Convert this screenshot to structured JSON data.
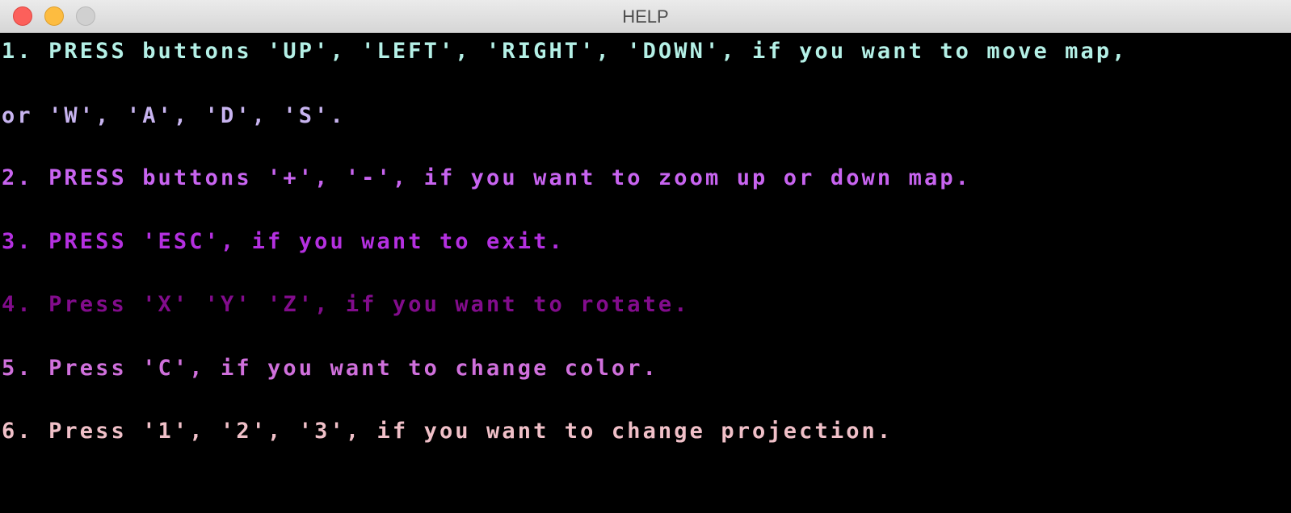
{
  "window": {
    "title": "HELP"
  },
  "help_lines": [
    {
      "text": "1. PRESS buttons 'UP', 'LEFT', 'RIGHT', 'DOWN', if you want to move map,",
      "color": "#b4f0e6"
    },
    {
      "text": "or 'W', 'A', 'D', 'S'.",
      "color": "#c8b4f0"
    },
    {
      "text": "2. PRESS buttons '+', '-', if you want to zoom up or down map.",
      "color": "#c864f0"
    },
    {
      "text": "3. PRESS 'ESC', if you want to exit.",
      "color": "#b430e0"
    },
    {
      "text": "4. Press 'X' 'Y' 'Z', if you want to rotate.",
      "color": "#820c8c"
    },
    {
      "text": "5. Press 'C', if you want to change color.",
      "color": "#d070dc"
    },
    {
      "text": "6. Press '1', '2', '3', if you want to change projection.",
      "color": "#f0c0c8"
    }
  ]
}
